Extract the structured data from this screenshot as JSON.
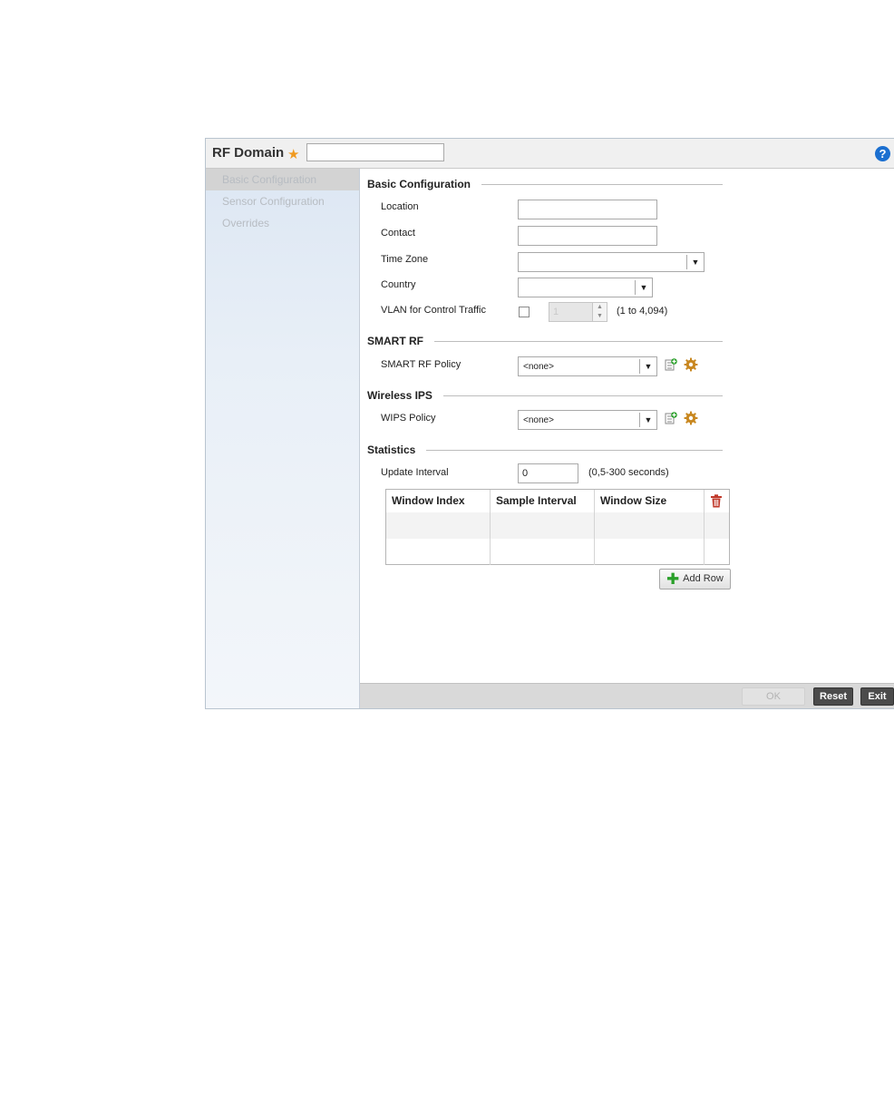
{
  "dialog": {
    "title": "RF Domain",
    "required_mark": "★",
    "name_value": "",
    "help_label": "?"
  },
  "sidebar": {
    "items": [
      {
        "label": "Basic Configuration"
      },
      {
        "label": "Sensor Configuration"
      },
      {
        "label": "Overrides"
      }
    ]
  },
  "basic": {
    "heading": "Basic Configuration",
    "location_label": "Location",
    "location_value": "",
    "contact_label": "Contact",
    "contact_value": "",
    "timezone_label": "Time Zone",
    "timezone_value": "",
    "country_label": "Country",
    "country_value": "",
    "vlan_label": "VLAN for Control Traffic",
    "vlan_value": "1",
    "vlan_range": "(1 to 4,094)"
  },
  "smart_rf": {
    "heading": "SMART RF",
    "policy_label": "SMART RF Policy",
    "policy_value": "<none>"
  },
  "wips": {
    "heading": "Wireless IPS",
    "policy_label": "WIPS Policy",
    "policy_value": "<none>"
  },
  "stats": {
    "heading": "Statistics",
    "interval_label": "Update Interval",
    "interval_value": "0",
    "interval_range": "(0,5-300 seconds)",
    "columns": [
      "Window Index",
      "Sample Interval",
      "Window Size"
    ],
    "add_row_label": "Add Row"
  },
  "footer": {
    "ok_label": "OK",
    "reset_label": "Reset",
    "exit_label": "Exit"
  },
  "glyphs": {
    "dropdown_arrow": "▼",
    "spin_up": "▲",
    "spin_down": "▼",
    "plus": "✚"
  },
  "colors": {
    "help": "#1b6fd0",
    "required": "#f09a20",
    "add_icon": "#2aa02a",
    "delete_icon": "#c0392b"
  }
}
